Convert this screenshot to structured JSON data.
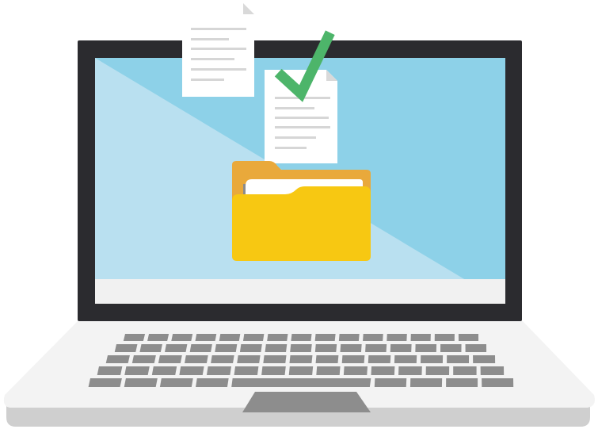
{
  "colors": {
    "background": "#ffffff",
    "bezel": "#2b2b2f",
    "screen_light": "#b9e0f0",
    "screen_dark": "#8dd1e8",
    "screen_bottom_bar": "#f1f1f1",
    "laptop_base": "#f3f3f3",
    "laptop_base_edge": "#cfcfcf",
    "keyboard_keys": "#8d8d8d",
    "trackpad": "#8d8d8d",
    "document_paper": "#ffffff",
    "document_fold": "#d9d9d9",
    "document_lines": "#d6d6d6",
    "checkmark": "#4db56a",
    "folder_back": "#e9a93b",
    "folder_front": "#f7c812",
    "folder_paper": "#ffffff",
    "folder_paper_shadow": "#8c8c8c"
  },
  "icons": [
    "laptop-icon",
    "document-icon",
    "checkmark-icon",
    "folder-icon"
  ],
  "keyboard_layout": {
    "rows": 5,
    "keys_per_row": [
      15,
      15,
      15,
      15,
      12
    ]
  }
}
